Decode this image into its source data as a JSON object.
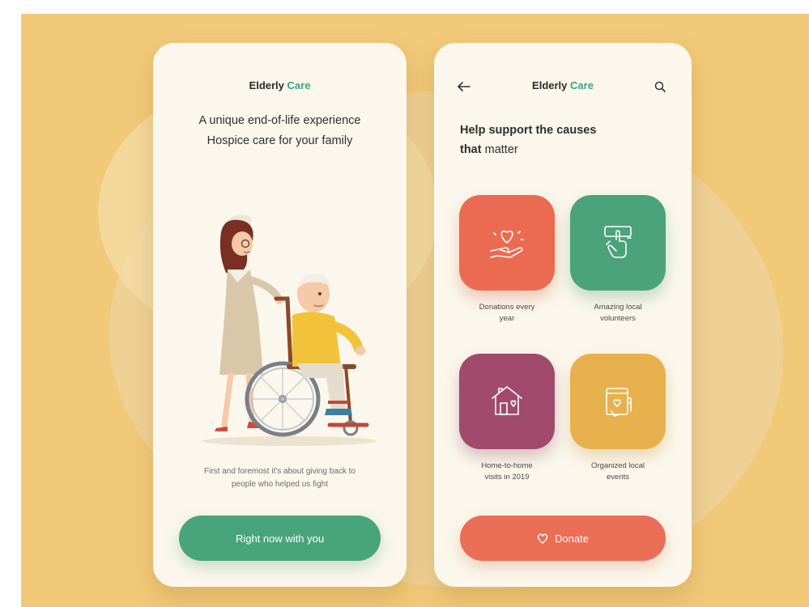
{
  "colors": {
    "background": "#f1c979",
    "card": "#fbf7ec",
    "brand_accent": "#3aa57c",
    "green": "#48a47a",
    "coral": "#ea6e55",
    "plum": "#a14a6c",
    "gold": "#e7b14e"
  },
  "left_screen": {
    "brand": {
      "name_part1": "Elderly",
      "name_part2": "Care"
    },
    "tagline_line1": "A unique end-of-life experience",
    "tagline_line2": "Hospice care for your family",
    "illustration": "nurse-pushing-elderly-man-in-wheelchair",
    "footer_line1": "First and foremost it's about giving back to",
    "footer_line2": "people who helped us fight",
    "cta_label": "Right now with you"
  },
  "right_screen": {
    "back_icon": "arrow-left-icon",
    "brand": {
      "name_part1": "Elderly",
      "name_part2": "Care"
    },
    "search_icon": "search-icon",
    "headline_bold": "Help support the causes",
    "headline_bold2": "that",
    "headline_light": " matter",
    "causes": [
      {
        "label_line1": "Donations every",
        "label_line2": "year",
        "icon": "heart-in-hand-icon",
        "color": "coral"
      },
      {
        "label_line1": "Amazing local",
        "label_line2": "volunteers",
        "icon": "hand-tap-icon",
        "color": "green"
      },
      {
        "label_line1": "Home-to-home",
        "label_line2": "visits in 2019",
        "icon": "home-heart-icon",
        "color": "plum"
      },
      {
        "label_line1": "Organized local",
        "label_line2": "events",
        "icon": "calendar-heart-icon",
        "color": "gold"
      }
    ],
    "cta_icon": "heart-outline-icon",
    "cta_label": "Donate"
  }
}
